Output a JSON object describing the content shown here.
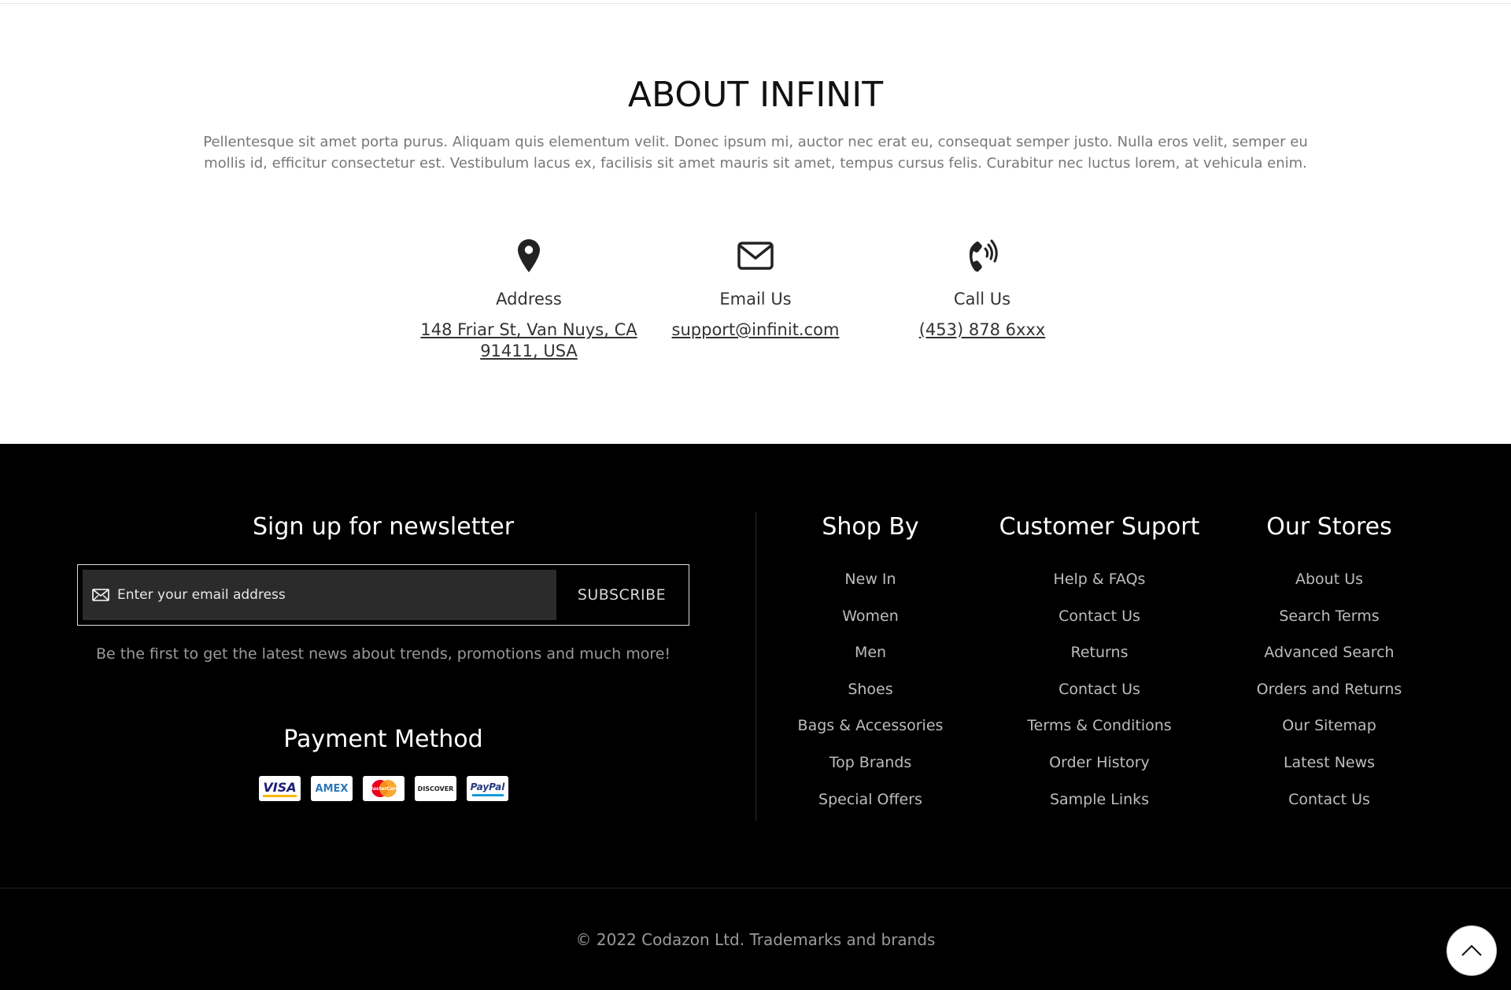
{
  "about": {
    "title": "ABOUT INFINIT",
    "description": "Pellentesque sit amet porta purus. Aliquam quis elementum velit. Donec ipsum mi, auctor nec erat eu, consequat semper justo. Nulla eros velit, semper eu mollis id, efficitur consectetur est. Vestibulum lacus ex, facilisis sit amet mauris sit amet, tempus cursus felis. Curabitur nec luctus lorem, at vehicula enim.",
    "contacts": [
      {
        "icon": "map-pin-icon",
        "label": "Address",
        "value": "148 Friar St, Van Nuys, CA 91411, USA"
      },
      {
        "icon": "mail-icon",
        "label": "Email Us",
        "value": "support@infinit.com"
      },
      {
        "icon": "phone-icon",
        "label": "Call Us",
        "value": "(453) 878 6xxx"
      }
    ]
  },
  "newsletter": {
    "title": "Sign up for newsletter",
    "placeholder": "Enter your email address",
    "button": "SUBSCRIBE",
    "note": "Be the first to get the latest news about trends, promotions and much more!"
  },
  "payment": {
    "title": "Payment Method",
    "cards": [
      "VISA",
      "AMEX",
      "MasterCard",
      "DISCOVER",
      "PayPal"
    ]
  },
  "footer_columns": [
    {
      "title": "Shop By",
      "links": [
        "New In",
        "Women",
        "Men",
        "Shoes",
        "Bags & Accessories",
        "Top Brands",
        "Special Offers"
      ]
    },
    {
      "title": "Customer Suport",
      "links": [
        "Help & FAQs",
        "Contact Us",
        "Returns",
        "Contact Us",
        "Terms & Conditions",
        "Order History",
        "Sample Links"
      ]
    },
    {
      "title": "Our Stores",
      "links": [
        "About Us",
        "Search Terms",
        "Advanced Search",
        "Orders and Returns",
        "Our Sitemap",
        "Latest News",
        "Contact Us"
      ]
    }
  ],
  "copyright": "© 2022 Codazon Ltd. Trademarks and brands",
  "colors": {
    "footer_bg": "#000000",
    "text_muted": "#9a9a9a",
    "accent_white": "#ffffff"
  }
}
